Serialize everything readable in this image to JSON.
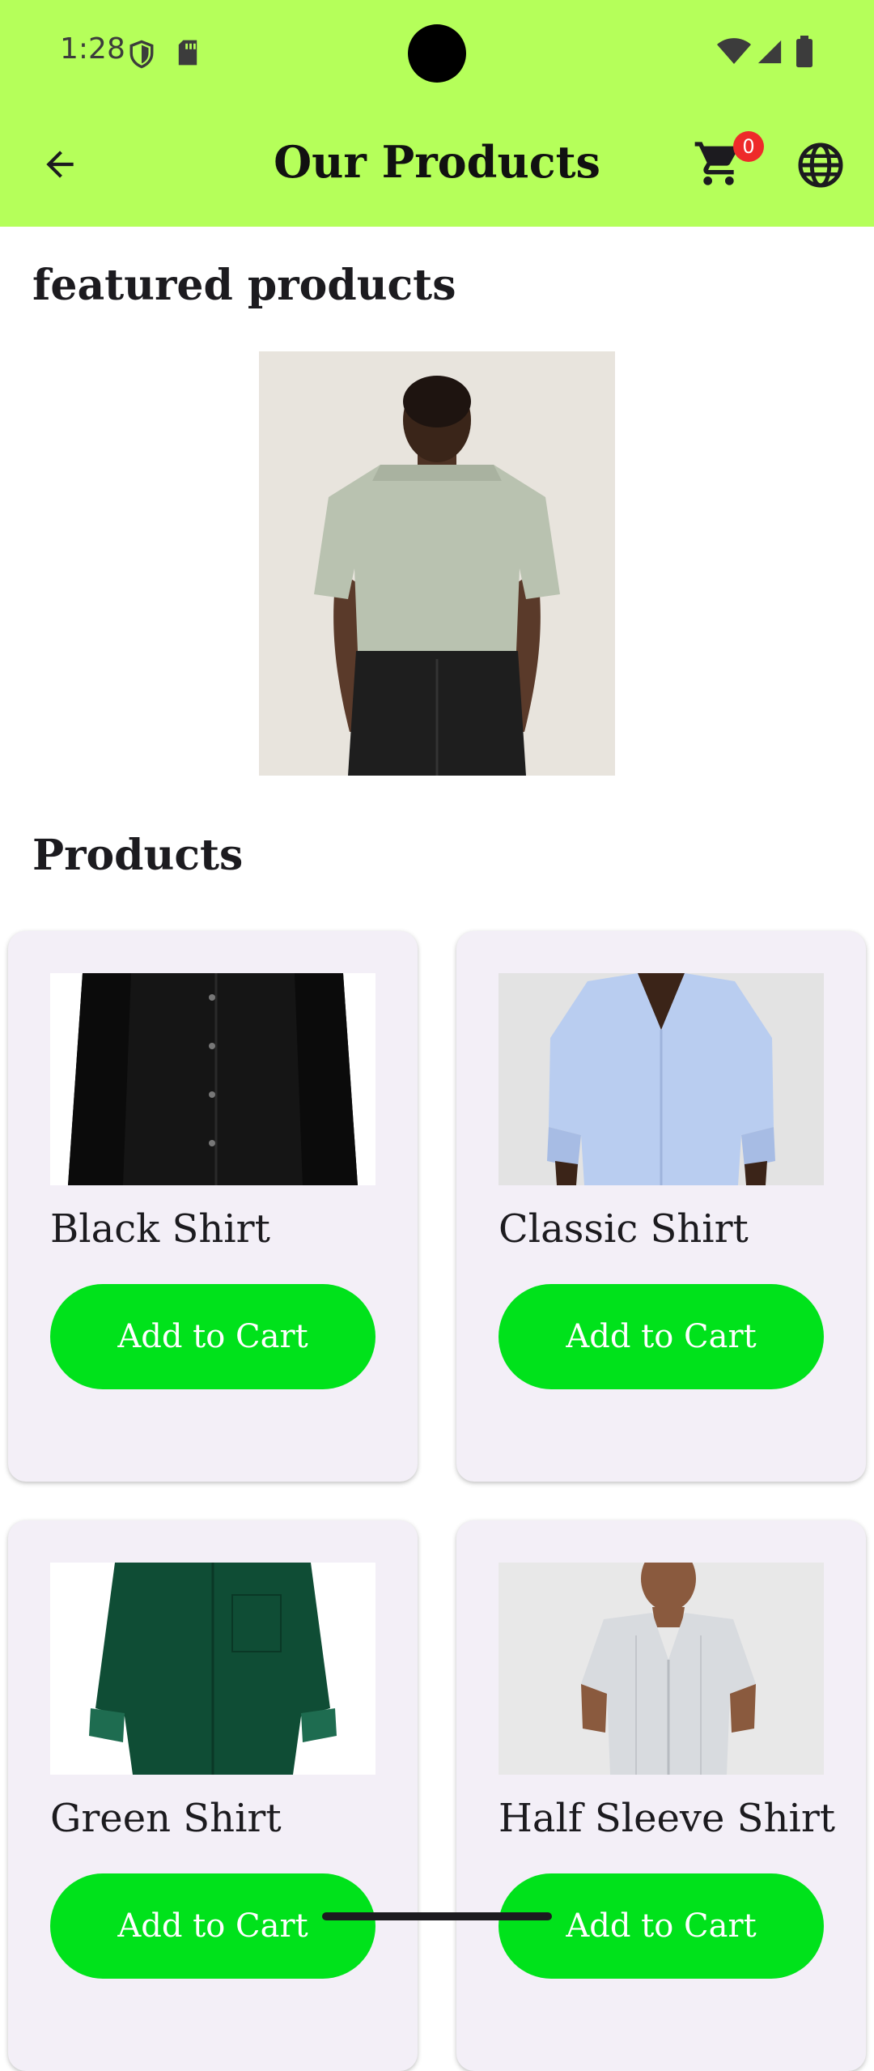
{
  "status_bar": {
    "time": "1:28"
  },
  "app_bar": {
    "title": "Our Products",
    "cart_count": "0",
    "icons": {
      "back": "arrow-back-icon",
      "cart": "shopping-cart-icon",
      "language": "globe-icon"
    }
  },
  "featured": {
    "heading": "featured products",
    "image": "tshirt-back-photo"
  },
  "products": {
    "heading": "Products",
    "items": [
      {
        "name": "Black Shirt",
        "button": "Add to Cart",
        "image": "black-shirt-photo"
      },
      {
        "name": "Classic Shirt",
        "button": "Add to Cart",
        "image": "classic-shirt-photo"
      },
      {
        "name": "Green Shirt",
        "button": "Add to Cart",
        "image": "green-shirt-photo"
      },
      {
        "name": "Half Sleeve Shirt",
        "button": "Add to Cart",
        "image": "half-sleeve-shirt-photo"
      }
    ]
  },
  "colors": {
    "app_bar": "#b5ff5a",
    "button": "#00e21b",
    "card": "#f3eff7",
    "badge": "#ee2a2a"
  }
}
